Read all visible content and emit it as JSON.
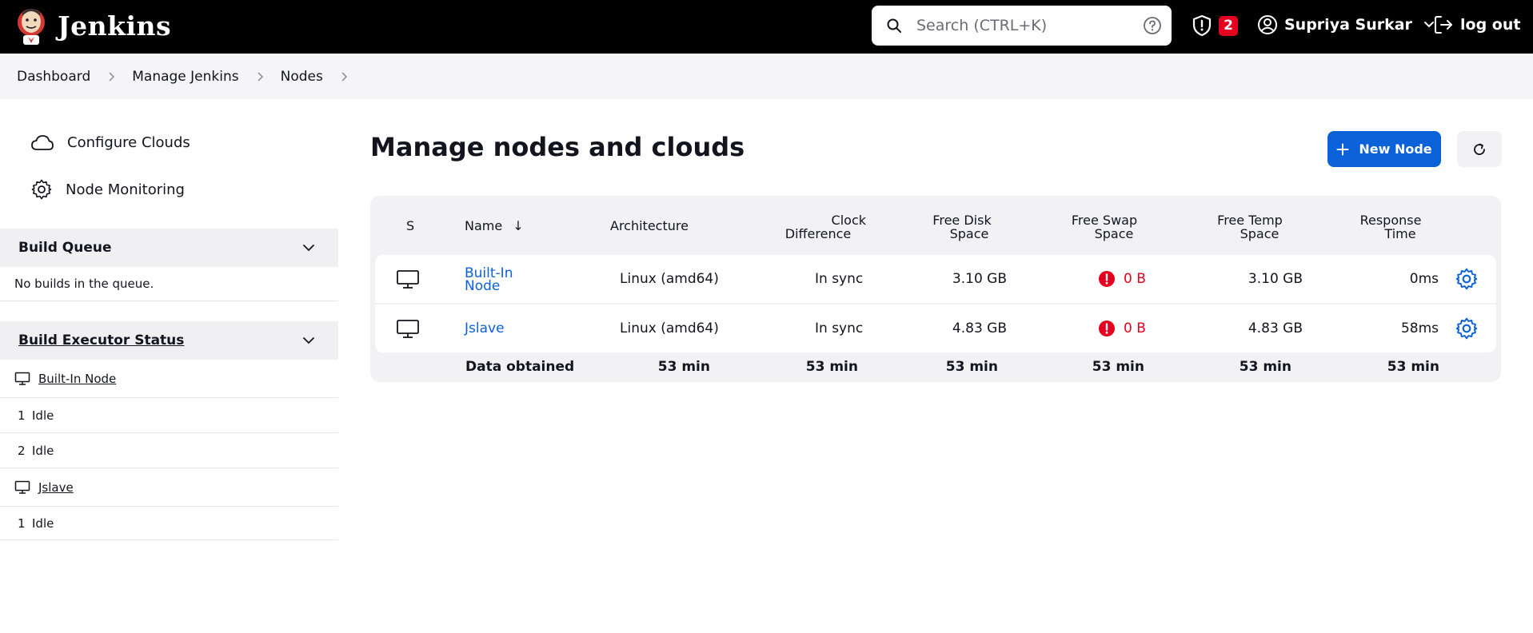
{
  "header": {
    "app_name": "Jenkins",
    "search_placeholder": "Search (CTRL+K)",
    "security_count": "2",
    "user_name": "Supriya Surkar",
    "logout_label": "log out"
  },
  "breadcrumb": [
    "Dashboard",
    "Manage Jenkins",
    "Nodes"
  ],
  "sidebar": {
    "tasks": [
      "Configure Clouds",
      "Node Monitoring"
    ],
    "build_queue": {
      "title": "Build Queue",
      "message": "No builds in the queue."
    },
    "executor_status": {
      "title": "Build Executor Status",
      "nodes": [
        {
          "name": "Built-In Node",
          "executors": [
            {
              "num": "1",
              "state": "Idle"
            },
            {
              "num": "2",
              "state": "Idle"
            }
          ]
        },
        {
          "name": "Jslave",
          "executors": [
            {
              "num": "1",
              "state": "Idle"
            }
          ]
        }
      ]
    }
  },
  "main": {
    "title": "Manage nodes and clouds",
    "new_node_label": "New Node",
    "table": {
      "headers": {
        "status": "S",
        "name": "Name",
        "sort_arrow": "↓",
        "architecture": "Architecture",
        "clock_1": "Clock",
        "clock_2": "Difference",
        "disk_1": "Free Disk",
        "disk_2": "Space",
        "swap_1": "Free Swap",
        "swap_2": "Space",
        "temp_1": "Free Temp",
        "temp_2": "Space",
        "resp_1": "Response",
        "resp_2": "Time"
      },
      "rows": [
        {
          "name_1": "Built-In",
          "name_2": "Node",
          "architecture": "Linux (amd64)",
          "clock": "In sync",
          "disk": "3.10 GB",
          "swap": "0 B",
          "temp": "3.10 GB",
          "response": "0ms"
        },
        {
          "name_1": "Jslave",
          "name_2": "",
          "architecture": "Linux (amd64)",
          "clock": "In sync",
          "disk": "4.83 GB",
          "swap": "0 B",
          "temp": "4.83 GB",
          "response": "58ms"
        }
      ],
      "footer": {
        "label": "Data obtained",
        "architecture": "53 min",
        "clock": "53 min",
        "disk": "53 min",
        "swap": "53 min",
        "temp": "53 min",
        "response": "53 min"
      }
    }
  },
  "colors": {
    "header_bg": "#000000",
    "accent": "#0b61d8",
    "danger": "#e6001f"
  }
}
